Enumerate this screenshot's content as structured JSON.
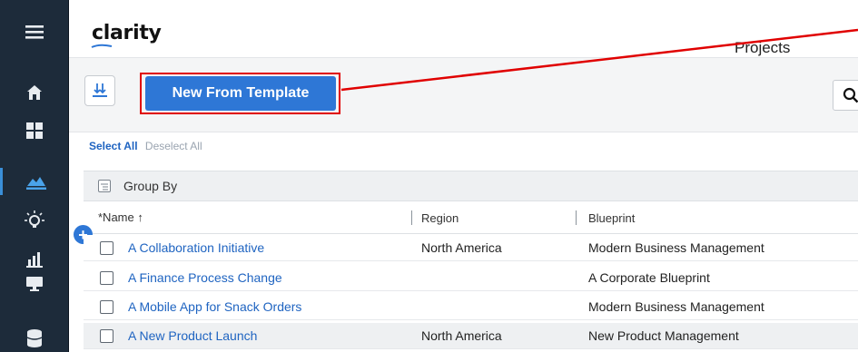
{
  "header": {
    "logo": "clarity",
    "page_title": "Projects"
  },
  "sidebar": {
    "items": [
      {
        "icon": "hamburger-menu-icon",
        "active": false
      },
      {
        "icon": "home-icon",
        "active": false
      },
      {
        "icon": "grid-icon",
        "active": false
      },
      {
        "icon": "mountain-chart-icon",
        "active": true
      },
      {
        "icon": "lightbulb-icon",
        "active": false
      },
      {
        "icon": "bar-chart-icon",
        "active": false
      },
      {
        "icon": "monitor-icon",
        "active": false
      },
      {
        "icon": "database-icon",
        "active": false
      }
    ]
  },
  "toolbar": {
    "download_icon": "download-icon",
    "new_from_template_label": "New From Template",
    "search_icon": "search-icon"
  },
  "selection": {
    "select_all": "Select All",
    "deselect_all": "Deselect All"
  },
  "grid": {
    "group_by_label": "Group By",
    "columns": {
      "name": "*Name ↑",
      "region": "Region",
      "blueprint": "Blueprint"
    },
    "rows": [
      {
        "name": "A Collaboration Initiative",
        "region": "North America",
        "blueprint": "Modern Business Management"
      },
      {
        "name": "A Finance Process Change",
        "region": "",
        "blueprint": "A Corporate Blueprint"
      },
      {
        "name": "A Mobile App for Snack Orders",
        "region": "",
        "blueprint": "Modern Business Management"
      },
      {
        "name": "A New Product Launch",
        "region": "North America",
        "blueprint": "New Product Management"
      }
    ]
  },
  "annotation": {
    "highlight_color": "#e00000"
  },
  "colors": {
    "sidebar_bg": "#1d2b3a",
    "accent": "#2e77d6",
    "link": "#1f64c1"
  }
}
